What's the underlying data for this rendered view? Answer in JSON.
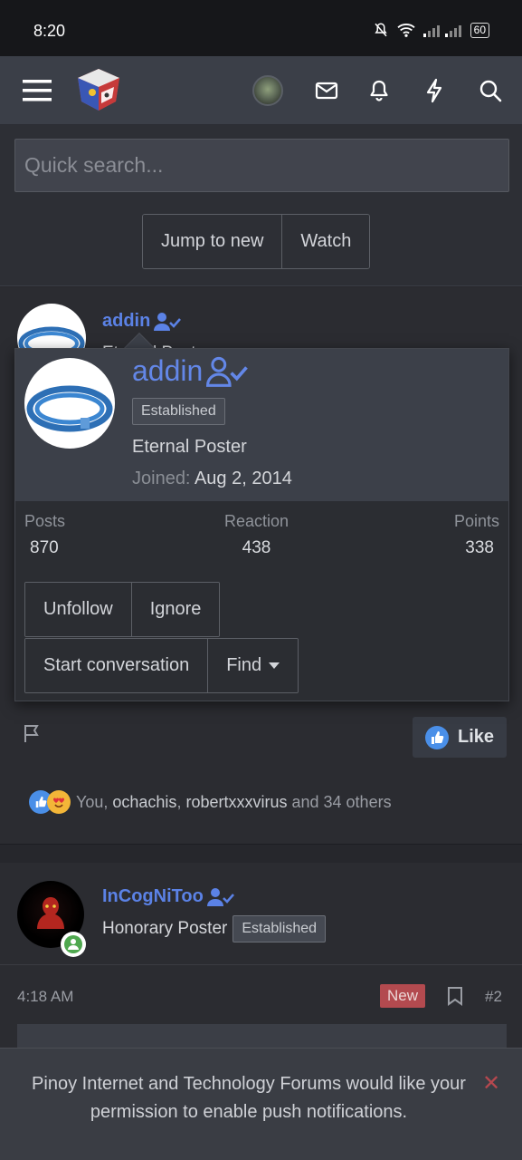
{
  "status_bar": {
    "time": "8:20",
    "battery": "60"
  },
  "navbar": {
    "icons": [
      "menu-icon",
      "site-logo",
      "avatar",
      "mail-icon",
      "bell-icon",
      "bolt-icon",
      "search-icon"
    ]
  },
  "search": {
    "placeholder": "Quick search..."
  },
  "actions": {
    "jump_label": "Jump to new",
    "watch_label": "Watch"
  },
  "post1": {
    "username": "addin",
    "obscured_title": "Eternal Poster",
    "actions": {
      "like_label": "Like"
    },
    "reactions": {
      "you": "You",
      "sep1": ", ",
      "user1": "ochachis",
      "sep2": ", ",
      "user2": "robertxxxvirus",
      "rest": " and 34 others"
    }
  },
  "tooltip": {
    "username": "addin",
    "badge": "Established",
    "title": "Eternal Poster",
    "joined_label": "Joined:",
    "joined_value": "Aug 2, 2014",
    "stats": [
      {
        "label": "Posts",
        "value": "870"
      },
      {
        "label": "Reaction",
        "value": "438"
      },
      {
        "label": "Points",
        "value": "338"
      }
    ],
    "buttons": {
      "unfollow": "Unfollow",
      "ignore": "Ignore",
      "start_conversation": "Start conversation",
      "find": "Find"
    }
  },
  "post2": {
    "username": "InCogNiToo",
    "title": "Honorary Poster",
    "badge": "Established",
    "time": "4:18 AM",
    "new_badge": "New",
    "number": "#2"
  },
  "push_notification": {
    "message": "Pinoy Internet and Technology Forums would like your permission to enable push notifications.",
    "close_glyph": "✕"
  },
  "colors": {
    "accent": "#5b82e6",
    "like_blue": "#4a8fe8",
    "new_badge": "#b34a4f"
  }
}
